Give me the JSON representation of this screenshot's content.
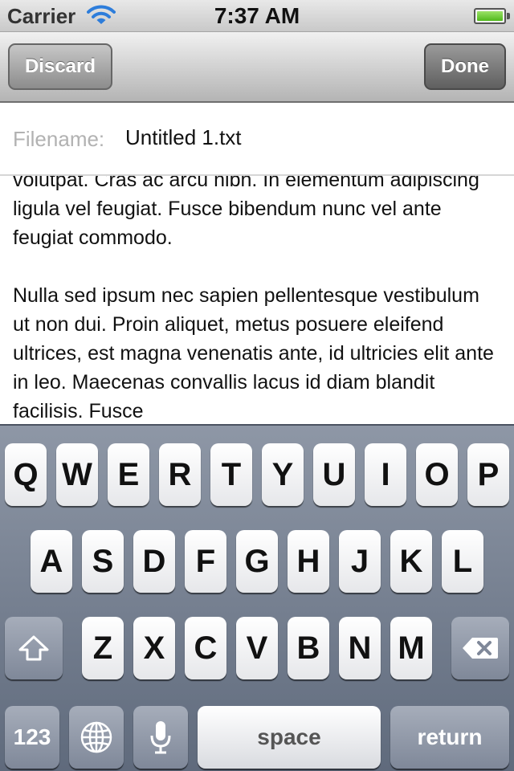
{
  "status_bar": {
    "carrier": "Carrier",
    "time": "7:37 AM",
    "wifi_icon": "wifi-icon",
    "battery_icon": "battery-icon",
    "battery_level": 1.0
  },
  "nav_bar": {
    "discard_label": "Discard",
    "done_label": "Done"
  },
  "filename": {
    "label": "Filename:",
    "value": "Untitled 1.txt"
  },
  "editor": {
    "paragraphs": [
      "volutpat. Cras ac arcu nibh. In elementum adipiscing ligula vel feugiat. Fusce bibendum nunc vel ante feugiat commodo.",
      "Nulla sed ipsum nec sapien pellentesque vestibulum ut non dui. Proin aliquet, metus posuere eleifend ultrices, est magna venenatis ante, id ultricies elit ante in leo. Maecenas convallis lacus id diam blandit facilisis. Fusce"
    ]
  },
  "keyboard": {
    "row1": [
      "Q",
      "W",
      "E",
      "R",
      "T",
      "Y",
      "U",
      "I",
      "O",
      "P"
    ],
    "row2": [
      "A",
      "S",
      "D",
      "F",
      "G",
      "H",
      "J",
      "K",
      "L"
    ],
    "row3": [
      "Z",
      "X",
      "C",
      "V",
      "B",
      "N",
      "M"
    ],
    "numbers_label": "123",
    "space_label": "space",
    "return_label": "return",
    "shift_icon": "shift-icon",
    "delete_icon": "delete-icon",
    "globe_icon": "globe-icon",
    "mic_icon": "microphone-icon"
  }
}
